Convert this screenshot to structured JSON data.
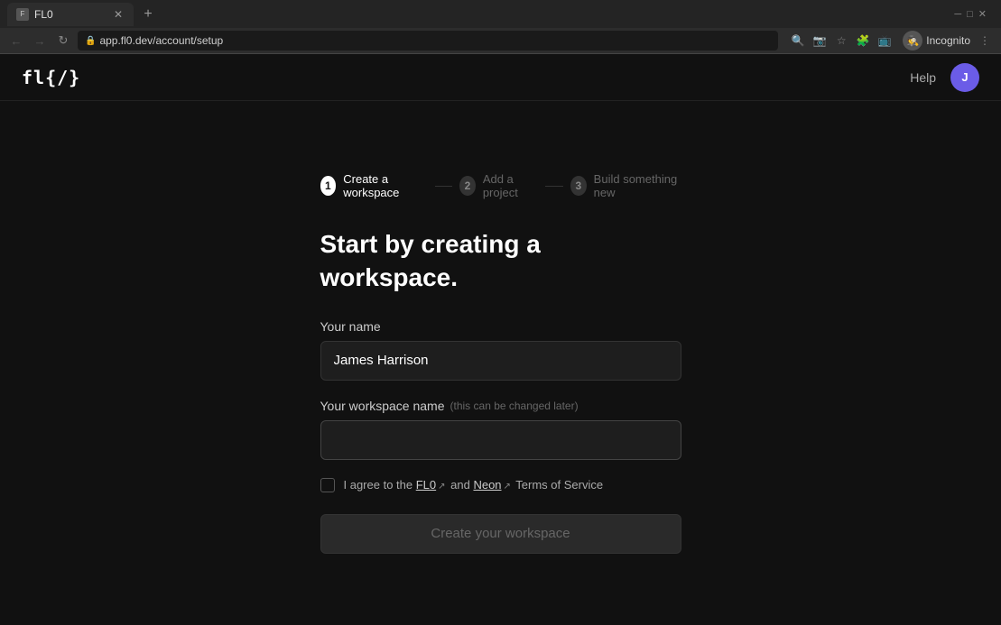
{
  "browser": {
    "tab_label": "FL0",
    "tab_favicon": "F",
    "address": "app.fl0.dev/account/setup",
    "incognito_label": "Incognito"
  },
  "navbar": {
    "logo": "fl{/}",
    "help_label": "Help",
    "user_initial": "J"
  },
  "stepper": {
    "steps": [
      {
        "number": "1",
        "label": "Create a workspace",
        "state": "active"
      },
      {
        "number": "2",
        "label": "Add a project",
        "state": "inactive"
      },
      {
        "number": "3",
        "label": "Build something new",
        "state": "inactive"
      }
    ]
  },
  "form": {
    "page_title": "Start by creating a workspace.",
    "name_label": "Your name",
    "name_value": "James Harrison",
    "workspace_label": "Your workspace name",
    "workspace_hint": "(this can be changed later)",
    "workspace_placeholder": "",
    "checkbox_text_1": "I agree to the ",
    "flo_link": "FL0",
    "and_text": " and ",
    "neon_link": "Neon",
    "tos_text": " Terms of Service",
    "submit_label": "Create your workspace"
  }
}
